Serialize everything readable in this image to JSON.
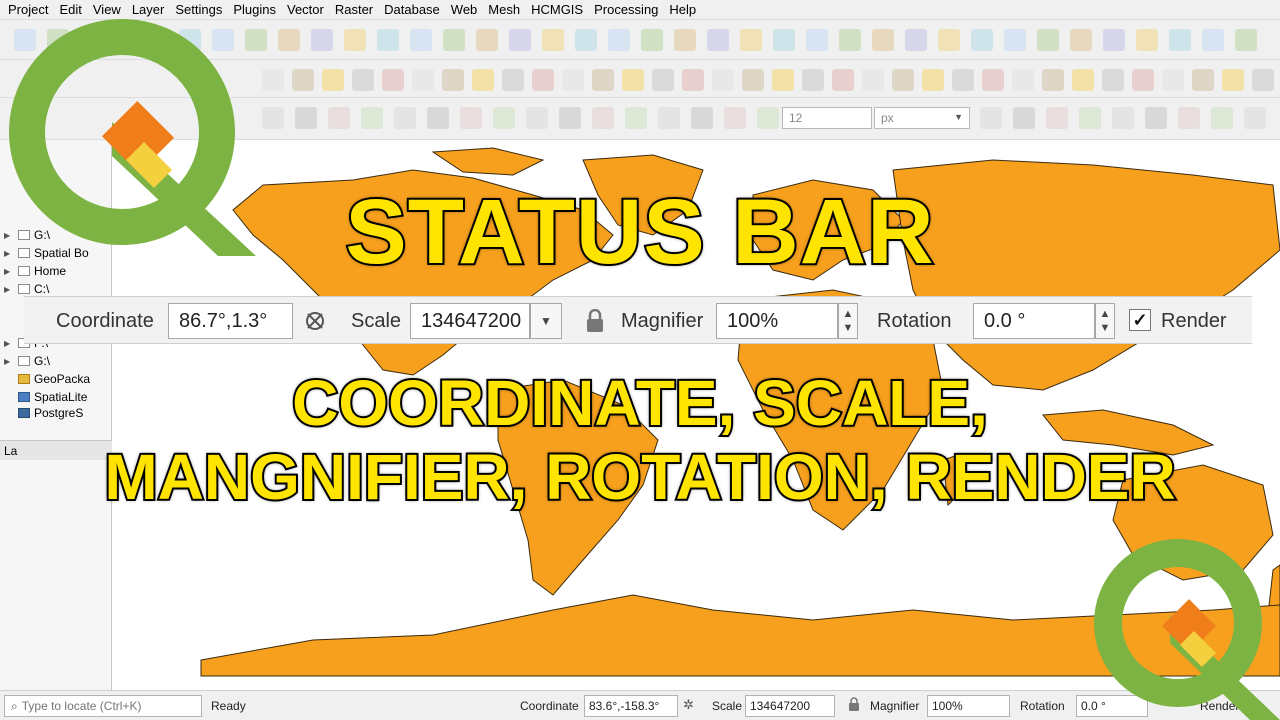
{
  "menu": [
    "Project",
    "Edit",
    "View",
    "Layer",
    "Settings",
    "Plugins",
    "Vector",
    "Raster",
    "Database",
    "Web",
    "Mesh",
    "HCMGIS",
    "Processing",
    "Help"
  ],
  "toolbar": {
    "snap_tolerance": "12",
    "snap_unit": "px"
  },
  "browser": {
    "items": [
      "G:\\",
      "Spatial Bo",
      "Home",
      "C:\\",
      "F:\\",
      "G:\\",
      "GeoPacka",
      "SpatiaLite",
      "PostgreS"
    ],
    "layers_header": "La"
  },
  "overlay": {
    "title": "STATUS BAR",
    "subtitle_line1": "COORDINATE, SCALE,",
    "subtitle_line2": "MANGNIFIER, ROTATION, RENDER"
  },
  "feature_bar": {
    "coordinate_label": "Coordinate",
    "coordinate_value": "86.7°,1.3°",
    "scale_label": "Scale",
    "scale_value": "134647200",
    "magnifier_label": "Magnifier",
    "magnifier_value": "100%",
    "rotation_label": "Rotation",
    "rotation_value": "0.0 °",
    "render_label": "Render",
    "render_checked": true
  },
  "status_bar": {
    "locate_placeholder": "Type to locate (Ctrl+K)",
    "message": "Ready",
    "coordinate_label": "Coordinate",
    "coordinate_value": "83.6°,-158.3°",
    "scale_label": "Scale",
    "scale_value": "134647200",
    "magnifier_label": "Magnifier",
    "magnifier_value": "100%",
    "rotation_label": "Rotation",
    "rotation_value": "0.0 °",
    "render_label": "Render"
  },
  "colors": {
    "land": "#f7a01e",
    "title": "#ffe400",
    "logo_green": "#7cb342",
    "logo_orange": "#ee7d1a"
  }
}
